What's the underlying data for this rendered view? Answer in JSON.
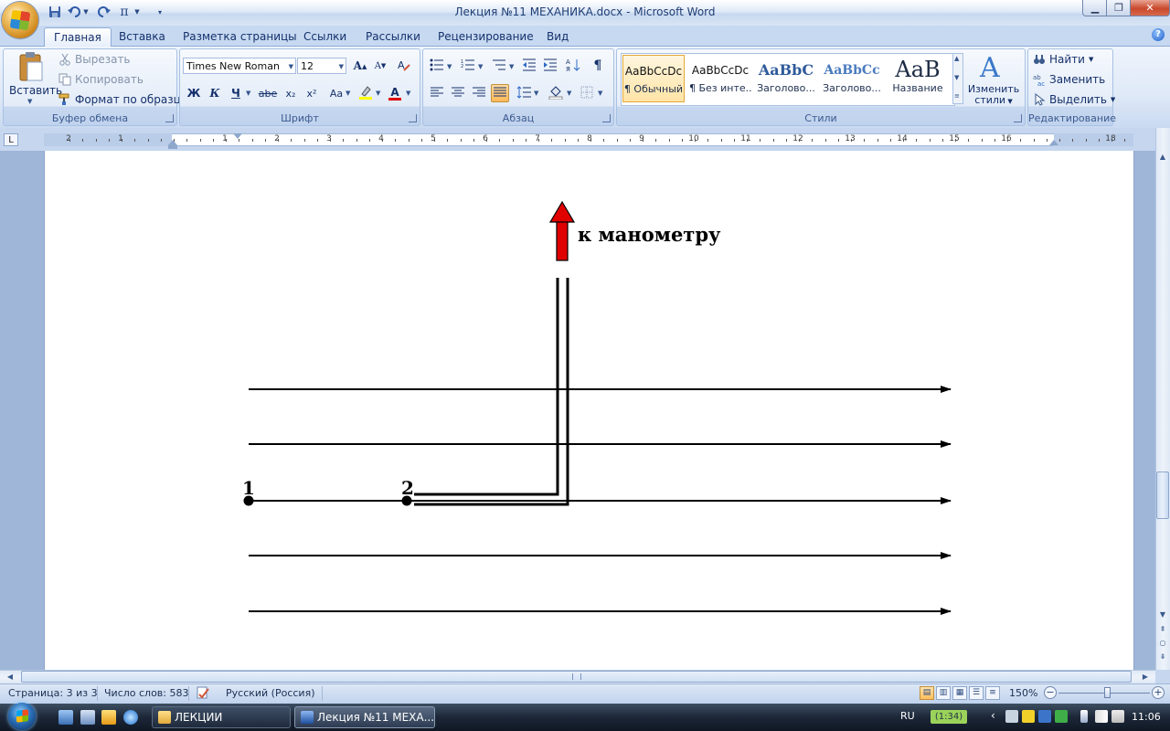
{
  "window": {
    "title": "Лекция №11 МЕХАНИКА.docx - Microsoft Word",
    "controls": {
      "minimize": "▁",
      "maximize": "❐",
      "close": "✕"
    }
  },
  "quick_access": {
    "save_icon": "save-icon",
    "undo_icon": "undo-icon",
    "redo_icon": "redo-icon",
    "symbol_label": "π"
  },
  "ribbon": {
    "tabs": [
      "Главная",
      "Вставка",
      "Разметка страницы",
      "Ссылки",
      "Рассылки",
      "Рецензирование",
      "Вид"
    ],
    "active_tab": "Главная",
    "clipboard": {
      "label": "Буфер обмена",
      "paste": "Вставить",
      "cut": "Вырезать",
      "copy": "Копировать",
      "format_painter": "Формат по образцу"
    },
    "font": {
      "label": "Шрифт",
      "font_name": "Times New Roman",
      "font_size": "12",
      "bold": "Ж",
      "italic": "К",
      "underline": "Ч",
      "strike": "abe",
      "subscript": "x₂",
      "superscript": "x²",
      "change_case": "Aa",
      "grow": "A",
      "shrink": "A",
      "font_color": "A"
    },
    "paragraph": {
      "label": "Абзац",
      "pilcrow": "¶"
    },
    "styles": {
      "label": "Стили",
      "items": [
        {
          "preview": "AaBbCcDc",
          "name": "¶ Обычный"
        },
        {
          "preview": "AaBbCcDc",
          "name": "¶ Без инте..."
        },
        {
          "preview": "AaBbC",
          "name": "Заголово..."
        },
        {
          "preview": "AaBbCc",
          "name": "Заголово..."
        },
        {
          "preview": "AaB",
          "name": "Название"
        }
      ],
      "change_styles_line1": "Изменить",
      "change_styles_line2": "стили"
    },
    "editing": {
      "label": "Редактирование",
      "find": "Найти",
      "replace": "Заменить",
      "select": "Выделить"
    }
  },
  "ruler": {
    "tab_selector": "L",
    "labels_left": [
      "2",
      "1"
    ],
    "labels_right": [
      "1",
      "2",
      "3",
      "4",
      "5",
      "6",
      "7",
      "8",
      "9",
      "10",
      "11",
      "12",
      "13",
      "14",
      "15",
      "16",
      "18"
    ]
  },
  "document": {
    "arrow_label": "к манометру",
    "point_1": "1",
    "point_2": "2",
    "arrow_color": "#e00000"
  },
  "status_bar": {
    "page": "Страница: 3 из 3",
    "words": "Число слов: 583",
    "language": "Русский (Россия)",
    "zoom": "150%",
    "zoom_minus": "−",
    "zoom_plus": "+",
    "zoom_level_percent": 150
  },
  "taskbar": {
    "buttons": [
      {
        "label": "ЛЕКЦИИ",
        "icon": "folder-icon",
        "active": false
      },
      {
        "label": "Лекция №11 МЕХА...",
        "icon": "word-icon",
        "active": true
      }
    ],
    "language": "RU",
    "timer": "(1:34)",
    "clock": "11:06"
  }
}
